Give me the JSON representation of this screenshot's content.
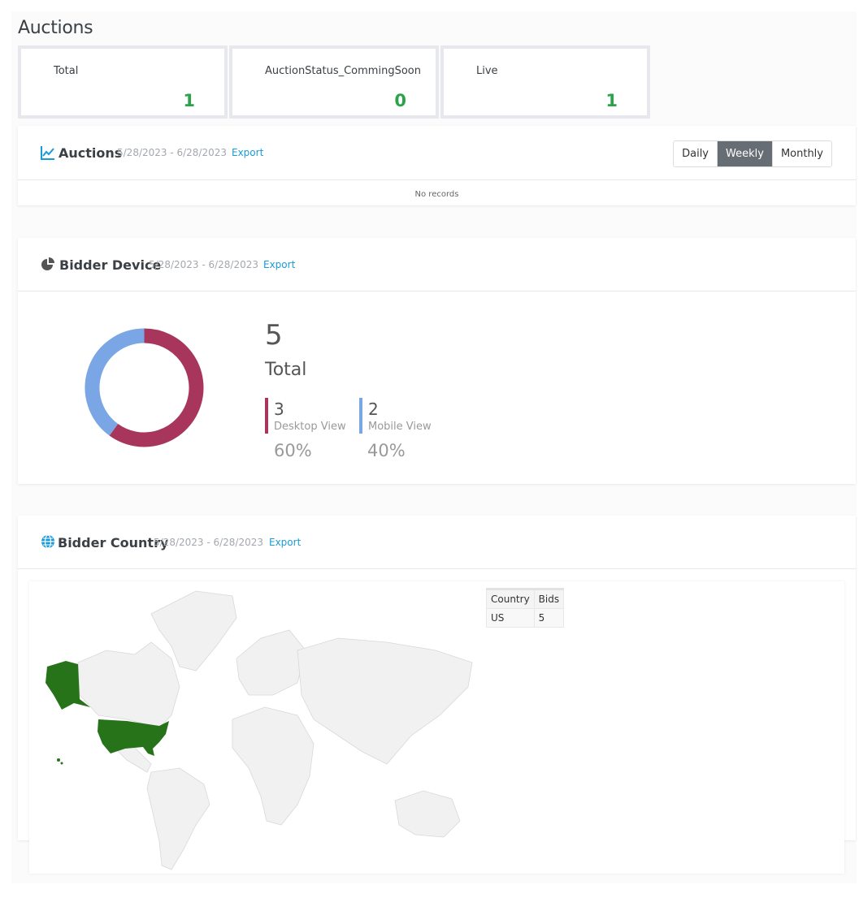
{
  "page": {
    "title": "Auctions"
  },
  "stats": [
    {
      "label": "Total",
      "value": "1"
    },
    {
      "label": "AuctionStatus_CommingSoon",
      "value": "0"
    },
    {
      "label": "Live",
      "value": "1"
    }
  ],
  "auctions_panel": {
    "title": "Auctions",
    "range": "5/28/2023 - 6/28/2023",
    "export": "Export",
    "periods": [
      "Daily",
      "Weekly",
      "Monthly"
    ],
    "active_period": "Weekly",
    "empty_text": "No records"
  },
  "device_panel": {
    "title": "Bidder Device",
    "range": "5/28/2023 - 6/28/2023",
    "export": "Export",
    "total_value": "5",
    "total_label": "Total",
    "items": [
      {
        "value": "3",
        "label": "Desktop View",
        "percent": "60%",
        "share": 0.6,
        "color": "#a8365c"
      },
      {
        "value": "2",
        "label": "Mobile View",
        "percent": "40%",
        "share": 0.4,
        "color": "#7aa6e6"
      }
    ]
  },
  "country_panel": {
    "title": "Bidder Country",
    "range": "5/28/2023 - 6/28/2023",
    "export": "Export",
    "table": {
      "headers": [
        "Country",
        "Bids"
      ],
      "rows": [
        [
          "US",
          "5"
        ]
      ]
    },
    "highlight_color": "#27731a"
  }
}
